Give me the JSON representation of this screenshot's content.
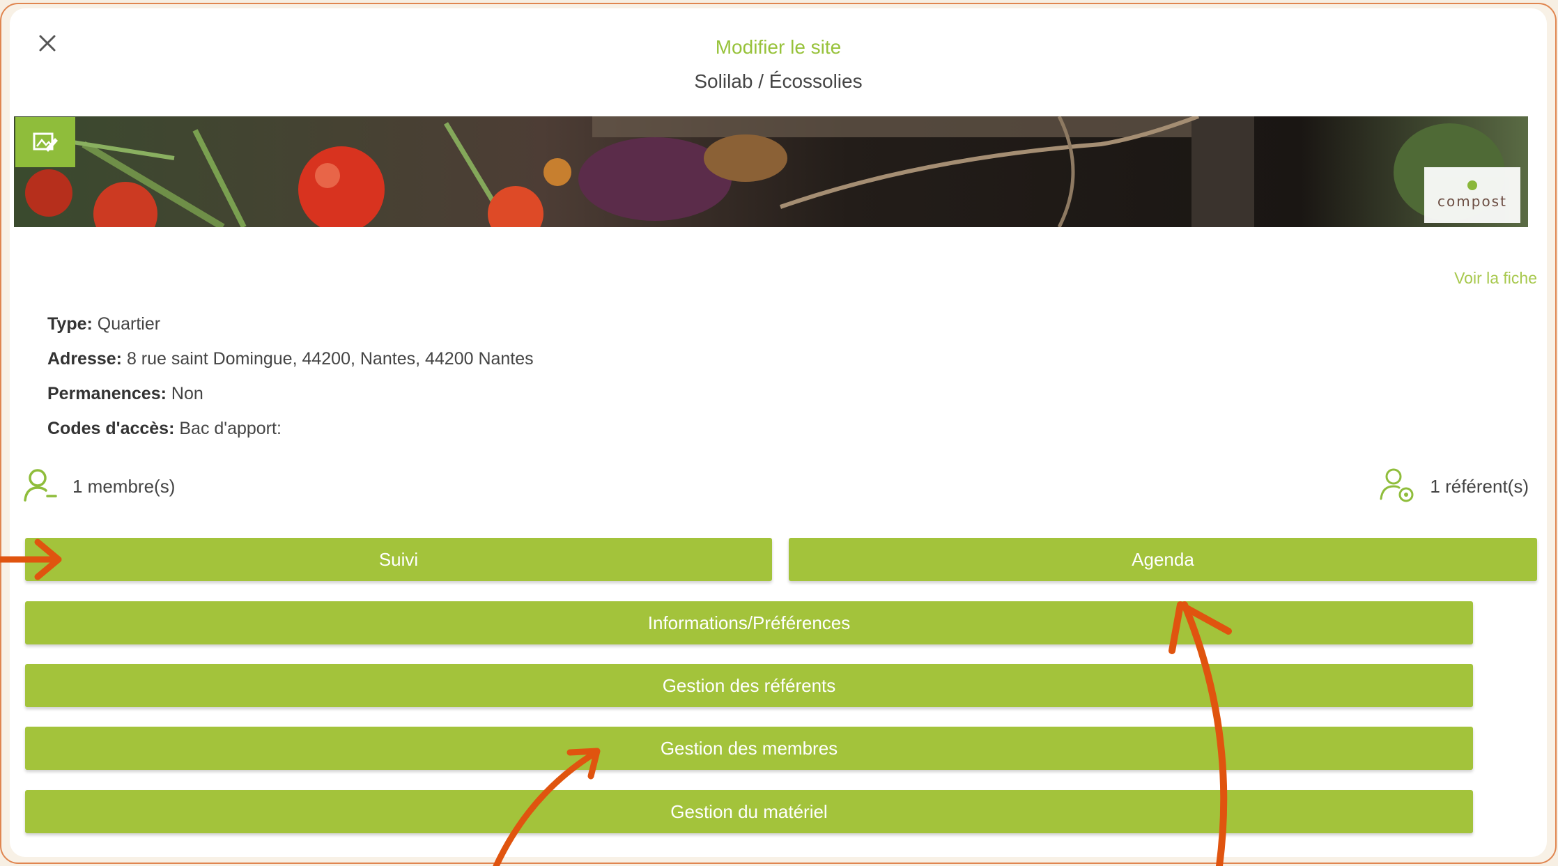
{
  "modal": {
    "title": "Modifier le site",
    "subtitle": "Solilab / Écossolies",
    "close_icon": "close-icon",
    "edit_icon": "edit-image-icon"
  },
  "banner": {
    "logo_text": "compost"
  },
  "voir_fiche": "Voir la fiche",
  "details": [
    {
      "label": "Type:",
      "value": " Quartier"
    },
    {
      "label": "Adresse:",
      "value": " 8 rue saint Domingue, 44200, Nantes, 44200 Nantes"
    },
    {
      "label": "Permanences:",
      "value": " Non"
    },
    {
      "label": "Codes d'accès:",
      "value": " Bac d'apport:"
    }
  ],
  "members": {
    "icon": "user-icon",
    "text": "1 membre(s)"
  },
  "referents": {
    "icon": "user-gear-icon",
    "text": "1 référent(s)"
  },
  "buttons": {
    "suivi": "Suivi",
    "agenda": "Agenda",
    "informations": "Informations/Préférences",
    "gestion_referents": "Gestion des référents",
    "gestion_membres": "Gestion des membres",
    "gestion_materiel": "Gestion du matériel"
  },
  "colors": {
    "accent": "#a3c33b",
    "title": "#97c23a",
    "annotation_arrow": "#e0540f",
    "frame_border": "#e08650"
  }
}
